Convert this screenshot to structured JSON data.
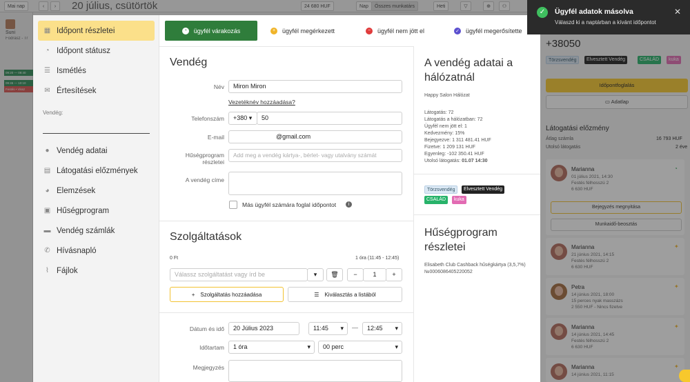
{
  "background": {
    "today_btn": "Mai nap",
    "date": "20 július, csütörtök",
    "revenue": "24 680 HUF",
    "view_day": "Nap",
    "staff_filter": "Összes munkatárs",
    "week_day": "Heti",
    "staff_name": "Suni",
    "staff_role": "Fodrász - Tr",
    "events": [
      "09:20 — 09:40",
      "09:45 — 10:10",
      "Festés • Vissz"
    ]
  },
  "nav": {
    "items": [
      {
        "label": "Időpont részletei",
        "icon": "calendar-icon"
      },
      {
        "label": "Időpont státusz",
        "icon": "clock-icon"
      },
      {
        "label": "Ismétlés",
        "icon": "list-icon"
      },
      {
        "label": "Értesítések",
        "icon": "chat-icon"
      }
    ],
    "guest_label": "Vendég:",
    "guest_items": [
      {
        "label": "Vendég adatai",
        "icon": "user-icon"
      },
      {
        "label": "Látogatási előzmények",
        "icon": "table-icon"
      },
      {
        "label": "Elemzések",
        "icon": "pie-icon"
      },
      {
        "label": "Hűségprogram",
        "icon": "gift-icon"
      },
      {
        "label": "Vendég számlák",
        "icon": "wallet-icon"
      },
      {
        "label": "Hívásnapló",
        "icon": "phone-icon"
      },
      {
        "label": "Fájlok",
        "icon": "paperclip-icon"
      }
    ]
  },
  "status_tabs": [
    {
      "label": "ügyfél várakozás",
      "color": "#2f7d3b"
    },
    {
      "label": "ügyfél megérkezett",
      "color": "#f0b429"
    },
    {
      "label": "ügyfél nem jött el",
      "color": "#e03b3b"
    },
    {
      "label": "ügyfél megerősítette",
      "color": "#5b4fcf"
    }
  ],
  "guest_form": {
    "title": "Vendég",
    "name_label": "Név",
    "name_value": "Miron Miron",
    "add_surname_link": "Vezetéknév hozzáadása?",
    "phone_label": "Telefonszám",
    "phone_prefix": "+380",
    "phone_value": "50",
    "email_label": "E-mail",
    "email_value": "@gmail.com",
    "loyalty_label": "Hűségprogram részletei",
    "loyalty_placeholder": "Add meg a vendég kártya-, bérlet- vagy utalvány számát",
    "address_label": "A vendég címe",
    "other_client_label": "Más ügyfél számára foglal időpontot"
  },
  "services": {
    "title": "Szolgáltatások",
    "total": "0 Ft",
    "duration_note": "1 óra (11:45 - 12:45)",
    "select_placeholder": "Válassz szolgáltatást vagy írd be",
    "quantity": "1",
    "add_button": "Szolgáltatás hozzáadása",
    "pick_button": "Kiválasztás a listából"
  },
  "datetime": {
    "date_label": "Dátum és idő",
    "date_value": "20 Július 2023",
    "start": "11:45",
    "end": "12:45",
    "dash": "—",
    "duration_label": "Időtartam",
    "hours": "1 óra",
    "minutes": "00 perc",
    "note_label": "Megjegyzés"
  },
  "network": {
    "title": "A vendég adatai a hálózatnál",
    "salon": "Happy Salon Hálózat",
    "stats": [
      "Látogatás: 72",
      "Látogatás a hálózatban: 72",
      "Ügyfél nem jött el: 1",
      "Kedvezmény: 15%",
      "Bejegyezve: 1 311 481.41 HUF",
      "Fizetve: 1 209 131 HUF",
      "Egyenleg: -102 350.41 HUF"
    ],
    "last_visit_label": "Utolsó látogatás:",
    "last_visit_value": "01.07 14:30",
    "tags": [
      "Törzsvendég",
      "Elvesztett Vendég",
      "CSALÁD",
      "kuka"
    ]
  },
  "loyalty": {
    "title": "Hűségprogram részletei",
    "card": "Elisabeth Club Cashback hűségkártya (3,5,7%) №0006086405220052"
  },
  "right": {
    "phone": "+38050",
    "book_btn": "Időpontfoglalás",
    "profile_btn": "Adatlap",
    "history_title": "Látogatási előzmény",
    "avg_label": "Átlag számla",
    "avg_value": "16 793 HUF",
    "last_label": "Utolsó látogatás",
    "last_value": "2 éve",
    "open_entry_btn": "Bejegyzés megnyitása",
    "schedule_btn": "Munkaidő-beosztás",
    "visits": [
      {
        "name": "Marianna",
        "date": "01 július 2021, 14:30",
        "service": "Festés félhosszú 2",
        "price": "6 630 HUF"
      },
      {
        "name": "Marianna",
        "date": "21 június 2021, 14:15",
        "service": "Festés félhosszú 2",
        "price": "6 630 HUF"
      },
      {
        "name": "Petra",
        "date": "14 június 2021, 18:00",
        "service": "15 perces nyak masszázs",
        "price": "2 550 HUF - Nincs fizetve"
      },
      {
        "name": "Marianna",
        "date": "14 június 2021, 14:45",
        "service": "Festés félhosszú 2",
        "price": "6 630 HUF"
      },
      {
        "name": "Marianna",
        "date": "14 június 2021, 11:15",
        "service": "",
        "price": ""
      }
    ]
  },
  "toast": {
    "title": "Ügyfél adatok másolva",
    "message": "Válaszd ki a naptárban a kívánt időpontot"
  }
}
